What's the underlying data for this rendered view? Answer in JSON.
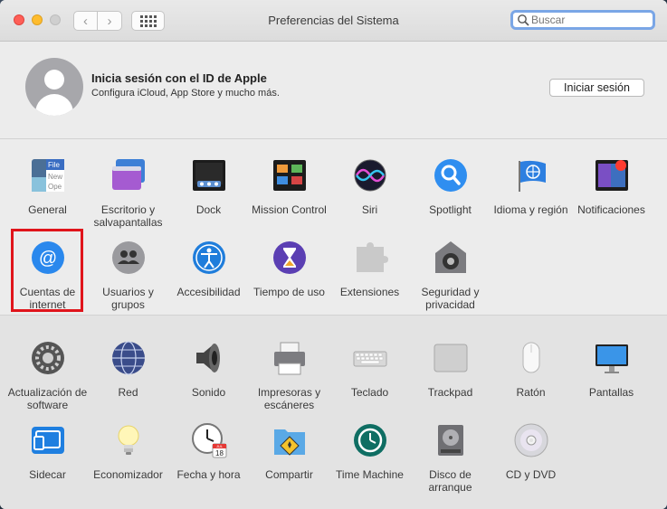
{
  "window": {
    "title": "Preferencias del Sistema"
  },
  "search": {
    "placeholder": "Buscar"
  },
  "apple_id": {
    "title": "Inicia sesión con el ID de Apple",
    "subtitle": "Configura iCloud, App Store y mucho más.",
    "button": "Iniciar sesión"
  },
  "row1": [
    {
      "label": "General",
      "icon": "general-icon"
    },
    {
      "label": "Escritorio y salvapantallas",
      "icon": "desktop-icon"
    },
    {
      "label": "Dock",
      "icon": "dock-icon"
    },
    {
      "label": "Mission Control",
      "icon": "mission-control-icon"
    },
    {
      "label": "Siri",
      "icon": "siri-icon"
    },
    {
      "label": "Spotlight",
      "icon": "spotlight-icon"
    },
    {
      "label": "Idioma y región",
      "icon": "language-icon"
    },
    {
      "label": "Notificaciones",
      "icon": "notifications-icon"
    }
  ],
  "row2": [
    {
      "label": "Cuentas de internet",
      "icon": "internet-accounts-icon"
    },
    {
      "label": "Usuarios y grupos",
      "icon": "users-icon"
    },
    {
      "label": "Accesibilidad",
      "icon": "accessibility-icon"
    },
    {
      "label": "Tiempo de uso",
      "icon": "screen-time-icon"
    },
    {
      "label": "Extensiones",
      "icon": "extensions-icon"
    },
    {
      "label": "Seguridad y privacidad",
      "icon": "security-icon"
    }
  ],
  "row3": [
    {
      "label": "Actualización de software",
      "icon": "software-update-icon"
    },
    {
      "label": "Red",
      "icon": "network-icon"
    },
    {
      "label": "Sonido",
      "icon": "sound-icon"
    },
    {
      "label": "Impresoras y escáneres",
      "icon": "printer-icon"
    },
    {
      "label": "Teclado",
      "icon": "keyboard-icon"
    },
    {
      "label": "Trackpad",
      "icon": "trackpad-icon"
    },
    {
      "label": "Ratón",
      "icon": "mouse-icon"
    },
    {
      "label": "Pantallas",
      "icon": "display-icon"
    }
  ],
  "row4": [
    {
      "label": "Sidecar",
      "icon": "sidecar-icon"
    },
    {
      "label": "Economizador",
      "icon": "energy-saver-icon"
    },
    {
      "label": "Fecha y hora",
      "icon": "date-time-icon"
    },
    {
      "label": "Compartir",
      "icon": "sharing-icon"
    },
    {
      "label": "Time Machine",
      "icon": "time-machine-icon"
    },
    {
      "label": "Disco de arranque",
      "icon": "startup-disk-icon"
    },
    {
      "label": "CD y DVD",
      "icon": "cd-dvd-icon"
    }
  ],
  "icon_text": {
    "general_file": "File",
    "general_new": "New",
    "general_open": "Ope",
    "calendar_month": "JUL",
    "calendar_day": "18"
  }
}
